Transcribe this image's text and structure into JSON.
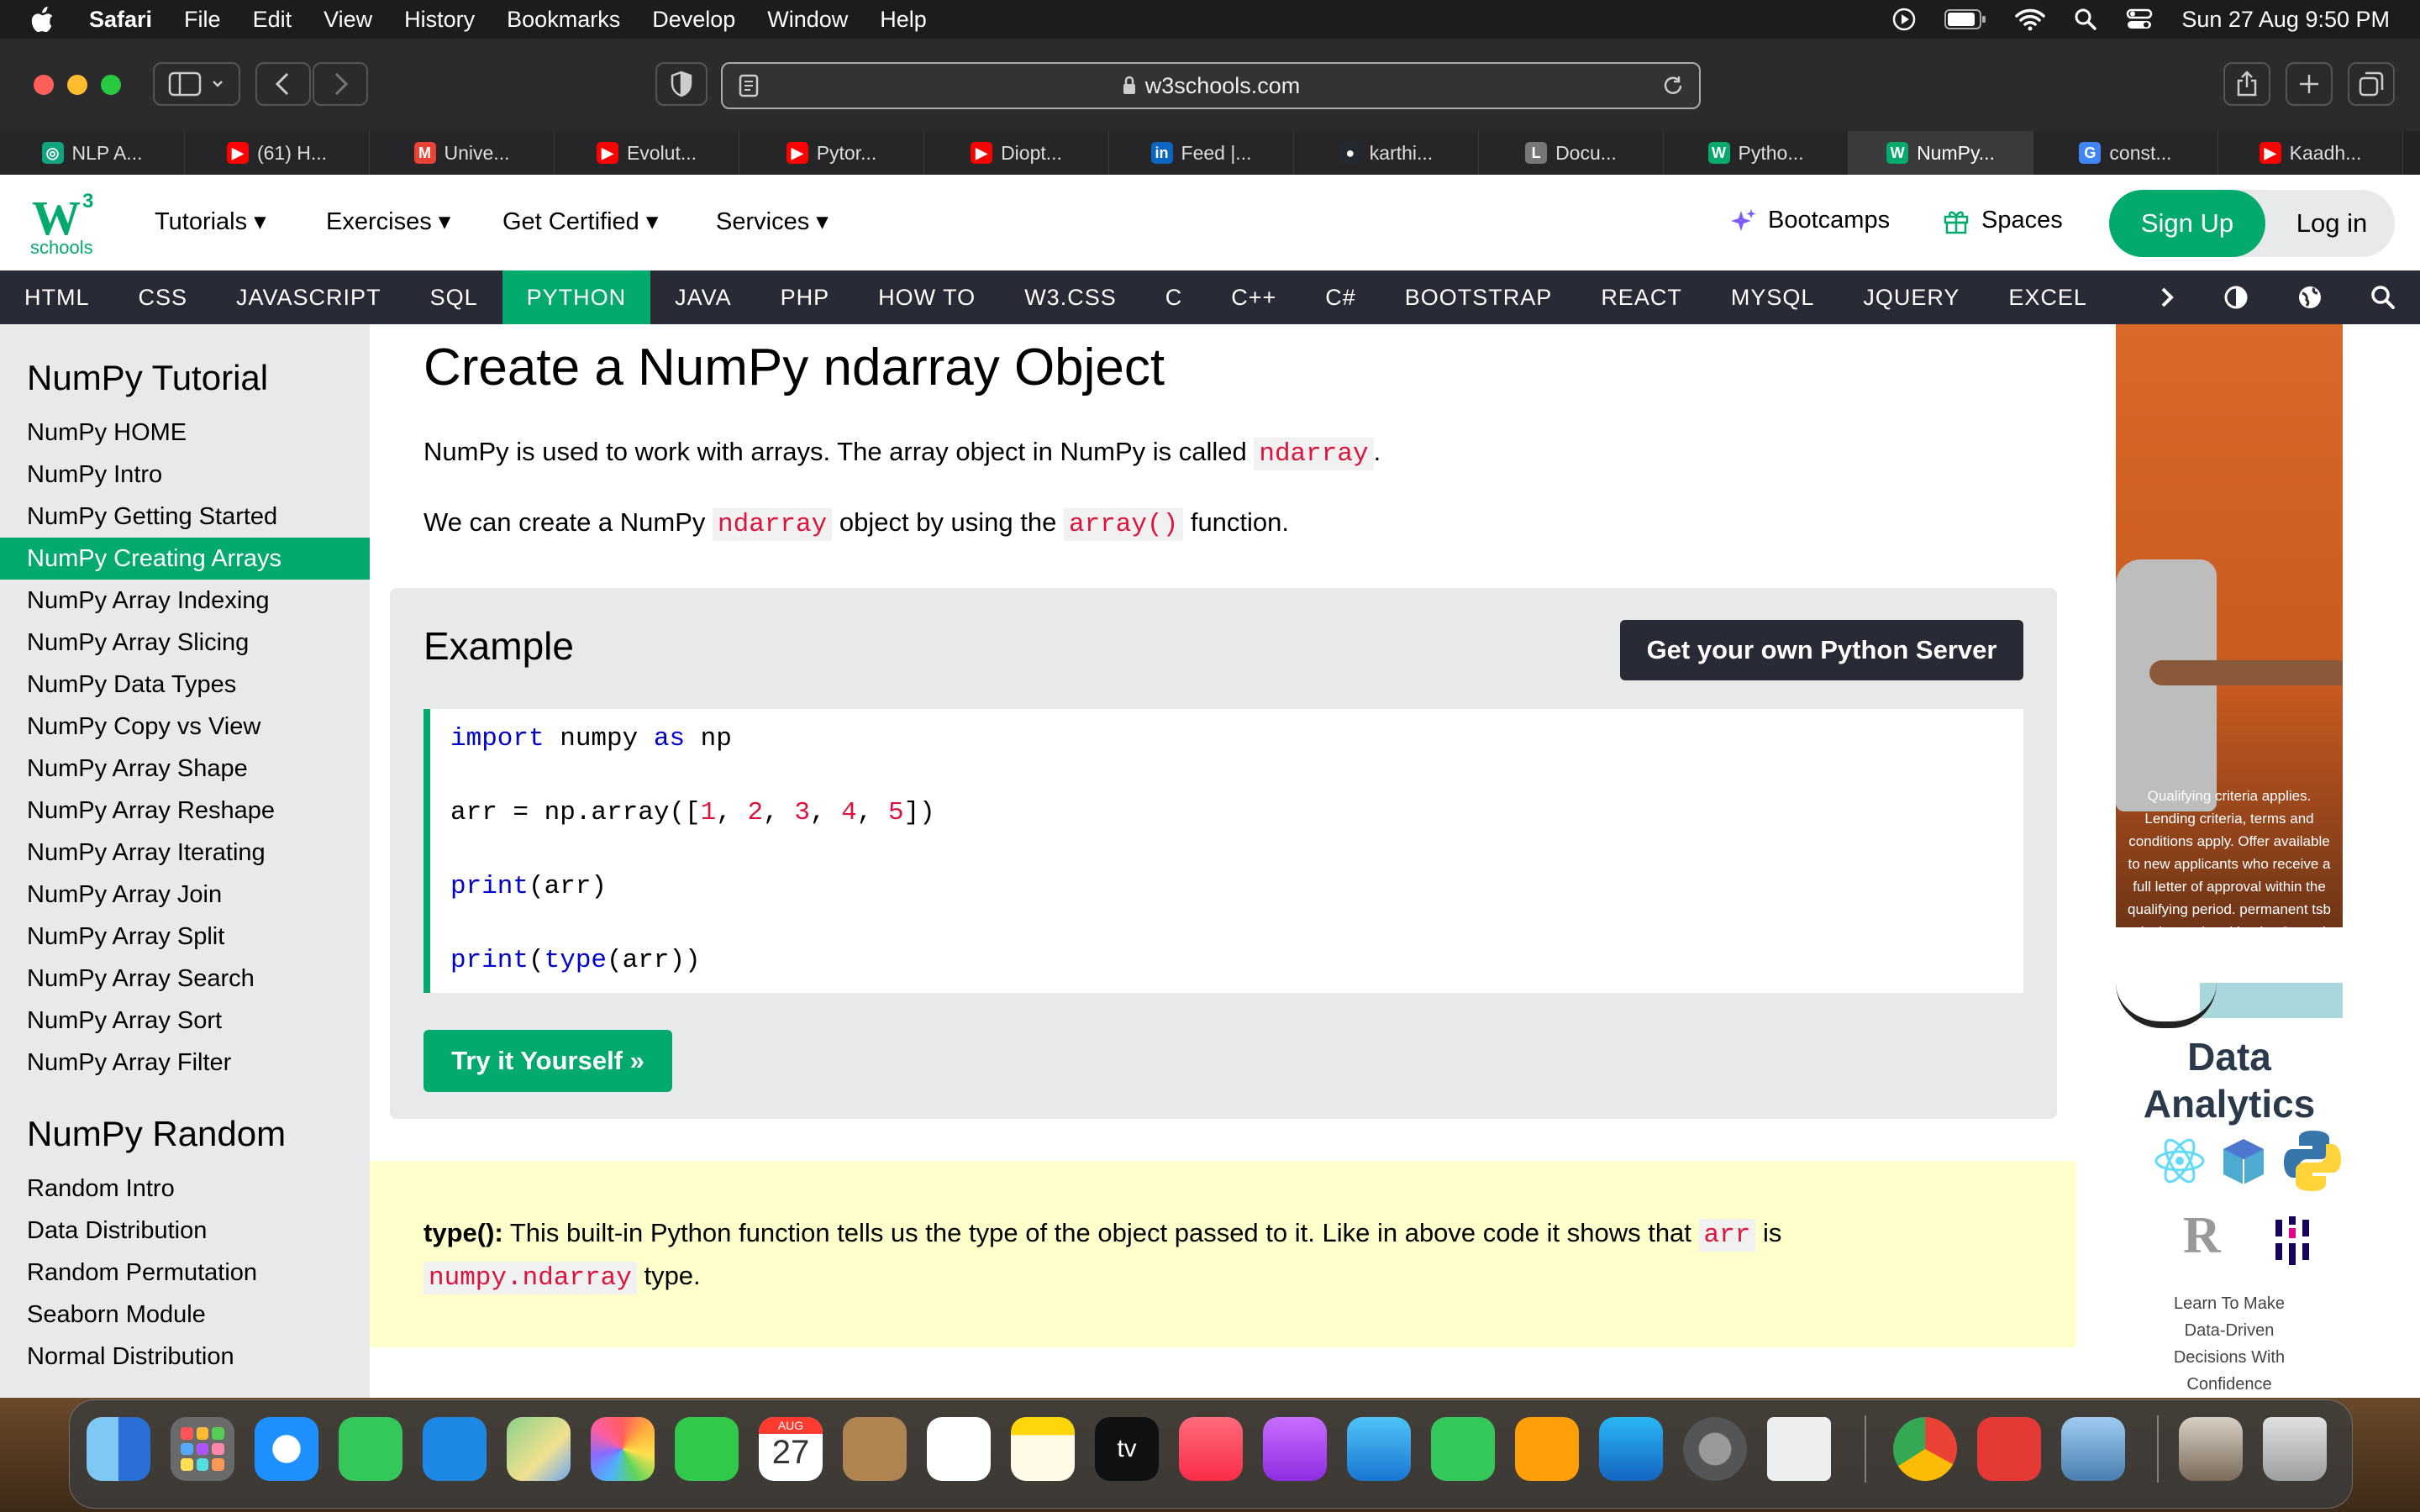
{
  "menubar": {
    "app": "Safari",
    "items": [
      "File",
      "Edit",
      "View",
      "History",
      "Bookmarks",
      "Develop",
      "Window",
      "Help"
    ],
    "datetime": "Sun 27 Aug  9:50 PM"
  },
  "browser": {
    "url": "w3schools.com",
    "tabs": [
      {
        "label": "NLP A...",
        "color": "#10a37f",
        "glyph": "◎"
      },
      {
        "label": "(61) H...",
        "color": "#ff0000",
        "glyph": "▶"
      },
      {
        "label": "Unive...",
        "color": "#ea4335",
        "glyph": "M"
      },
      {
        "label": "Evolut...",
        "color": "#ff0000",
        "glyph": "▶"
      },
      {
        "label": "Pytor...",
        "color": "#ff0000",
        "glyph": "▶"
      },
      {
        "label": "Diopt...",
        "color": "#ff0000",
        "glyph": "▶"
      },
      {
        "label": "Feed |...",
        "color": "#0a66c2",
        "glyph": "in"
      },
      {
        "label": "karthi...",
        "color": "#24292f",
        "glyph": "●"
      },
      {
        "label": "Docu...",
        "color": "#777777",
        "glyph": "L"
      },
      {
        "label": "Pytho...",
        "color": "#04aa6d",
        "glyph": "W"
      },
      {
        "label": "NumPy...",
        "color": "#04aa6d",
        "glyph": "W"
      },
      {
        "label": "const...",
        "color": "#4285f4",
        "glyph": "G"
      },
      {
        "label": "Kaadh...",
        "color": "#ff0000",
        "glyph": "▶"
      }
    ]
  },
  "w3": {
    "logo_sup": "3",
    "logo_sub": "schools",
    "nav": [
      "Tutorials",
      "Exercises",
      "Get Certified",
      "Services"
    ],
    "bootcamps": "Bootcamps",
    "spaces": "Spaces",
    "signup": "Sign Up",
    "login": "Log in",
    "topnav": [
      "HTML",
      "CSS",
      "JAVASCRIPT",
      "SQL",
      "PYTHON",
      "JAVA",
      "PHP",
      "HOW TO",
      "W3.CSS",
      "C",
      "C++",
      "C#",
      "BOOTSTRAP",
      "REACT",
      "MYSQL",
      "JQUERY",
      "EXCEL"
    ]
  },
  "sidebar": {
    "heading1": "NumPy Tutorial",
    "items1": [
      "NumPy HOME",
      "NumPy Intro",
      "NumPy Getting Started",
      "NumPy Creating Arrays",
      "NumPy Array Indexing",
      "NumPy Array Slicing",
      "NumPy Data Types",
      "NumPy Copy vs View",
      "NumPy Array Shape",
      "NumPy Array Reshape",
      "NumPy Array Iterating",
      "NumPy Array Join",
      "NumPy Array Split",
      "NumPy Array Search",
      "NumPy Array Sort",
      "NumPy Array Filter"
    ],
    "heading2": "NumPy Random",
    "items2": [
      "Random Intro",
      "Data Distribution",
      "Random Permutation",
      "Seaborn Module",
      "Normal Distribution"
    ]
  },
  "main": {
    "title": "Create a NumPy ndarray Object",
    "p1_a": "NumPy is used to work with arrays. The array object in NumPy is called ",
    "p1_code": "ndarray",
    "p1_b": ".",
    "p2_a": "We can create a NumPy ",
    "p2_code1": "ndarray",
    "p2_b": " object by using the ",
    "p2_code2": "array()",
    "p2_c": " function.",
    "example_title": "Example",
    "server_button": "Get your own Python Server",
    "code": {
      "l1_kw1": "import",
      "l1_mid": " numpy ",
      "l1_kw2": "as",
      "l1_end": " np",
      "l2_a": "arr = np.array([",
      "n1": "1",
      "n2": "2",
      "n3": "3",
      "n4": "4",
      "n5": "5",
      "l2_end": "])",
      "l3_kw": "print",
      "l3_end": "(arr)",
      "l4_kw1": "print",
      "l4_p": "(",
      "l4_kw2": "type",
      "l4_end": "(arr))"
    },
    "try_button": "Try it Yourself »",
    "note_bold": "type():",
    "note_a": " This built-in Python function tells us the type of the object passed to it. Like in above code it shows that ",
    "note_code1": "arr",
    "note_b": " is",
    "note_code2": "numpy.ndarray",
    "note_c": " type."
  },
  "ads": {
    "ad1_text": "Qualifying criteria applies. Lending criteria, terms and conditions apply. Offer available to new applicants who receive a full letter of approval within the qualifying period. permanent tsb plc. is regulated by the Central Bank of Ireland.",
    "ad2_title1": "Data",
    "ad2_title2": "Analytics",
    "ad2_r": "R",
    "ad2_sub1": "Learn To Make",
    "ad2_sub2": "Data-Driven",
    "ad2_sub3": "Decisions With",
    "ad2_sub4": "Confidence"
  },
  "dock": {
    "calendar_month": "AUG",
    "calendar_day": "27",
    "tv_label": "tv"
  }
}
